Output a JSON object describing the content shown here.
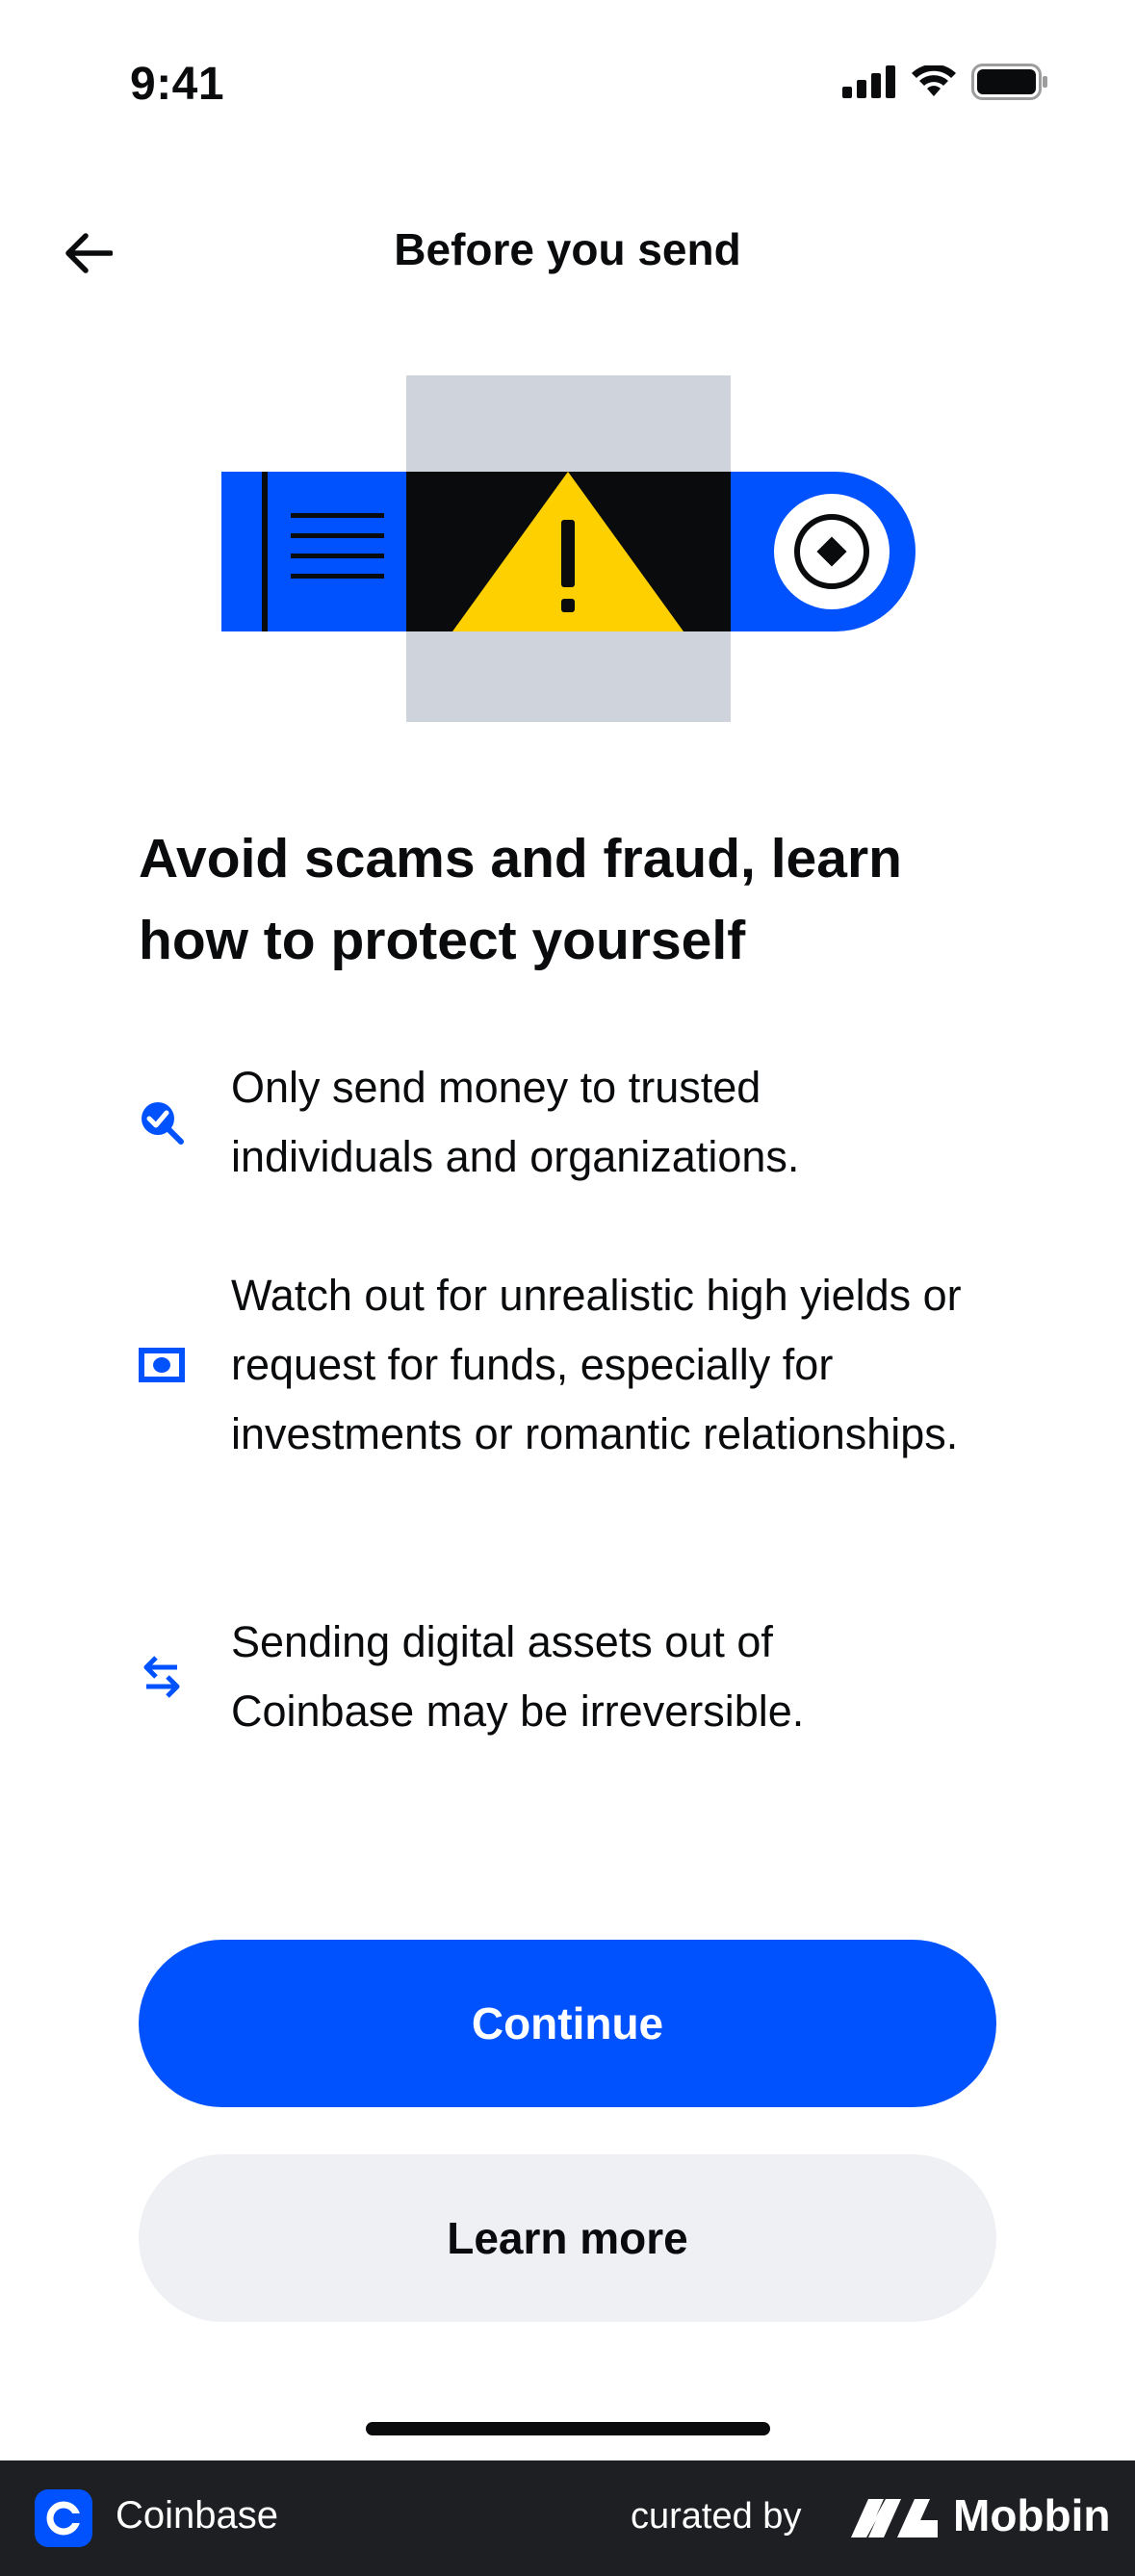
{
  "status_bar": {
    "time": "9:41"
  },
  "header": {
    "title": "Before you send"
  },
  "icons": {
    "back": "arrow-left-icon",
    "tips": [
      "verified-search-icon",
      "cash-bill-icon",
      "transfer-arrows-icon"
    ]
  },
  "heading": "Avoid scams and fraud, learn how to protect yourself",
  "tips": [
    "Only send money to trusted individuals and organizations.",
    "Watch out for unrealistic high yields or request for funds, especially for investments or romantic relationships.",
    "Sending digital assets out of Coinbase may be irreversible."
  ],
  "buttons": {
    "continue": "Continue",
    "learn_more": "Learn more"
  },
  "footer": {
    "app_name": "Coinbase",
    "curated_by": "curated by",
    "brand": "Mobbin"
  },
  "colors": {
    "accent": "#0052ff",
    "warning": "#ffd000",
    "dark": "#0a0b0d",
    "illustration_gray": "#cfd3dc"
  }
}
